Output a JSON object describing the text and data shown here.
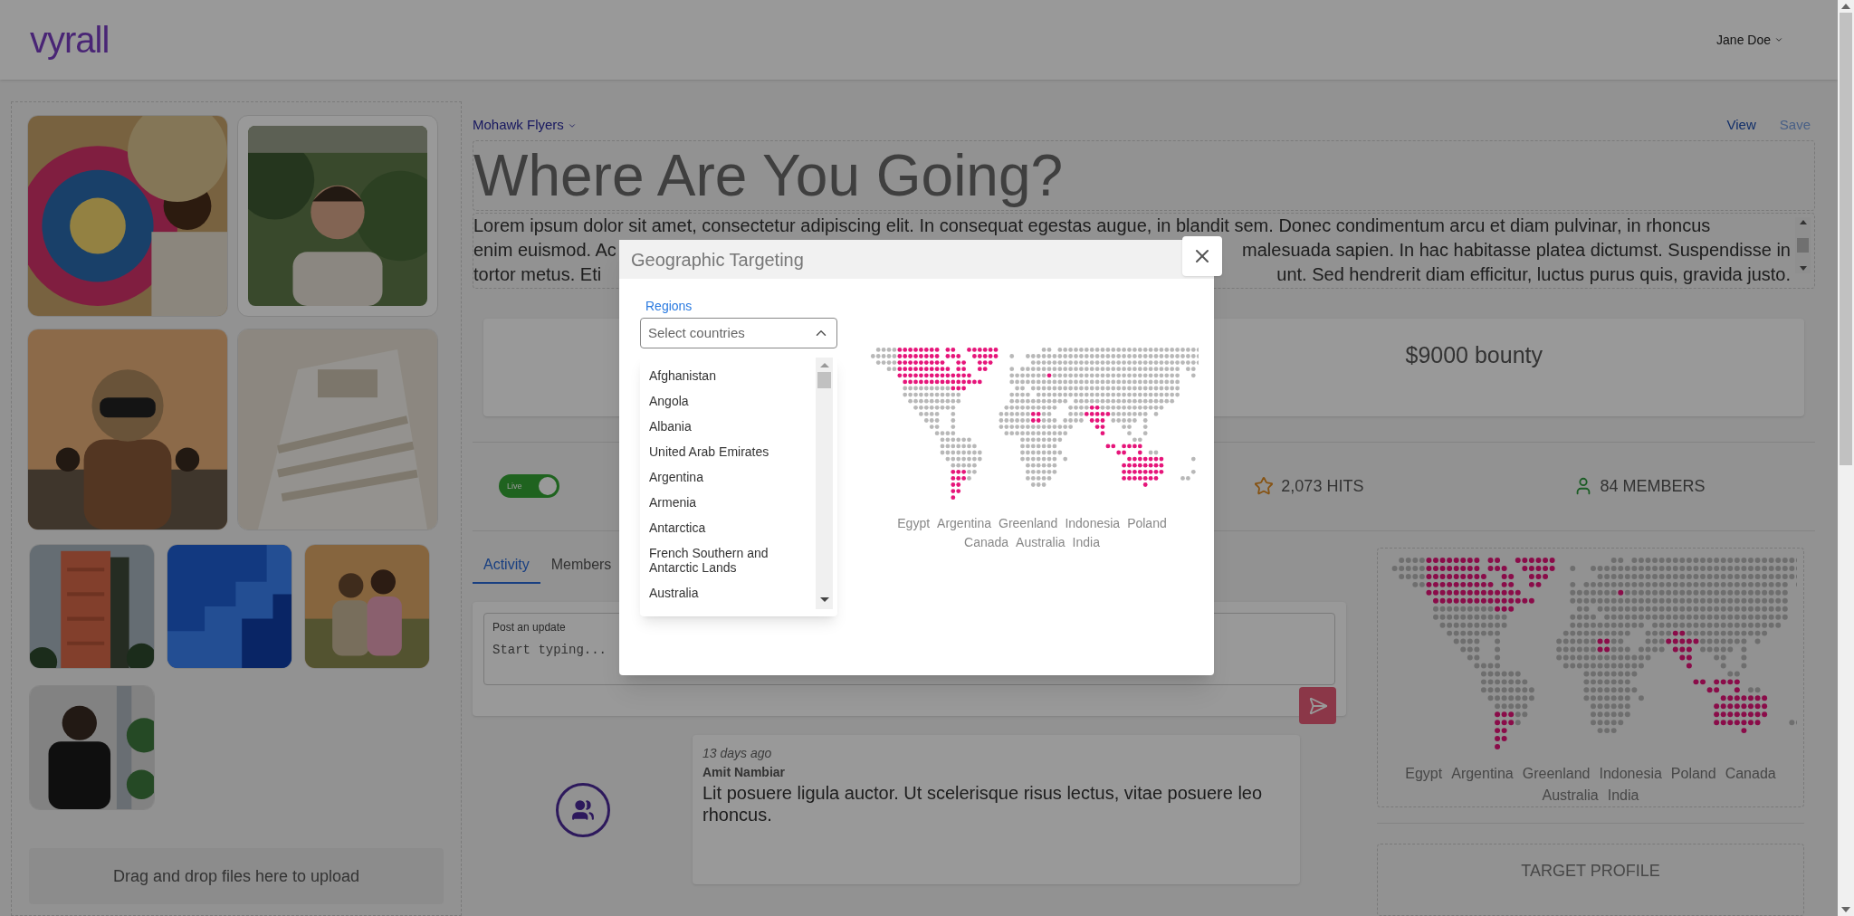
{
  "header": {
    "logo": "vyrall",
    "user": "Jane Doe"
  },
  "gallery": {
    "upload_hint": "Drag and drop files here to upload"
  },
  "campaign": {
    "team": "Mohawk Flyers",
    "actions": [
      {
        "label": "View",
        "disabled": false
      },
      {
        "label": "Save",
        "disabled": true
      }
    ],
    "title": "Where Are You Going?",
    "description_lines": [
      {
        "left": "Lorem ipsum dolor sit amet, consectetur adipiscing elit. In consequat egestas augue, in blandit sem. Donec condimentum arcu et diam pulvinar, in rhoncus"
      },
      {
        "left": "enim euismod. Ac",
        "right": "malesuada sapien. In hac habitasse platea dictumst. Suspendisse in"
      },
      {
        "left": "tortor metus. Eti",
        "right": "unt. Sed hendrerit diam efficitur, luctus purus quis, gravida justo."
      }
    ],
    "bounty": "$9000 bounty"
  },
  "stats": {
    "live": {
      "label": "Live",
      "on": true
    },
    "hits": "2,073 HITS",
    "members": "84 MEMBERS"
  },
  "tabs": [
    {
      "label": "Activity",
      "selected": true
    },
    {
      "label": "Members",
      "selected": false
    }
  ],
  "post": {
    "label": "Post an update",
    "placeholder": "Start typing..."
  },
  "activity": [
    {
      "time": "13 days ago",
      "author": "Amit Nambiar",
      "text": "Lit posuere ligula auctor. Ut scelerisque risus lectus, vitae posuere leo rhoncus."
    }
  ],
  "target_map": {
    "countries": [
      "Egypt",
      "Argentina",
      "Greenland",
      "Indonesia",
      "Poland",
      "Canada",
      "Australia",
      "India"
    ]
  },
  "target_profile": {
    "title": "TARGET PROFILE"
  },
  "modal": {
    "title": "Geographic Targeting",
    "regions": {
      "label": "Regions",
      "placeholder": "Select countries",
      "expanded": true,
      "options": [
        "Afghanistan",
        "Angola",
        "Albania",
        "United Arab Emirates",
        "Argentina",
        "Armenia",
        "Antarctica",
        "French Southern and Antarctic Lands",
        "Australia"
      ]
    },
    "countries": [
      "Egypt",
      "Argentina",
      "Greenland",
      "Indonesia",
      "Poland",
      "Canada",
      "Australia",
      "India"
    ]
  }
}
